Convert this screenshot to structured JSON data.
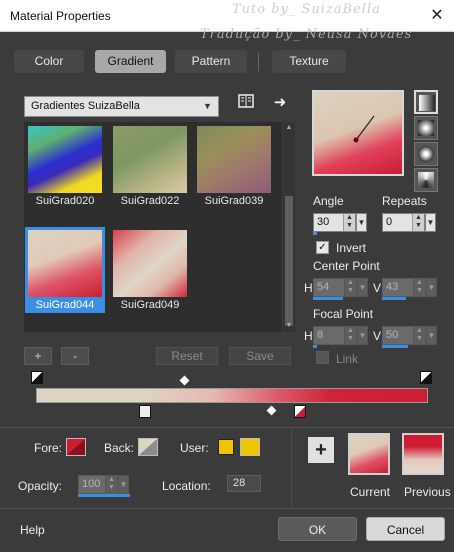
{
  "window": {
    "title": "Material Properties",
    "close_label": "✕"
  },
  "watermark": {
    "line1": "Tuto by_ SuizaBella",
    "line2": "Tradução by_ Neusa Novaes"
  },
  "tabs": [
    {
      "label": "Color",
      "active": false
    },
    {
      "label": "Gradient",
      "active": true
    },
    {
      "label": "Pattern",
      "active": false
    },
    {
      "label": "Texture",
      "active": false
    }
  ],
  "gradient_list": {
    "selected": "Gradientes SuizaBella",
    "items": [
      {
        "label": "SuiGrad020",
        "selected": false
      },
      {
        "label": "SuiGrad022",
        "selected": false
      },
      {
        "label": "SuiGrad039",
        "selected": false
      },
      {
        "label": "SuiGrad044",
        "selected": true
      },
      {
        "label": "SuiGrad049",
        "selected": false
      }
    ]
  },
  "list_buttons": {
    "add": "+",
    "remove": "-",
    "reset": "Reset",
    "save": "Save"
  },
  "angle": {
    "label": "Angle",
    "value": "30"
  },
  "repeats": {
    "label": "Repeats",
    "value": "0"
  },
  "invert": {
    "label": "Invert",
    "checked": true
  },
  "center_point": {
    "label": "Center Point",
    "h_label": "H",
    "h": "54",
    "v_label": "V",
    "v": "43"
  },
  "focal_point": {
    "label": "Focal Point",
    "h_label": "H",
    "h": "8",
    "v_label": "V",
    "v": "50"
  },
  "link": {
    "label": "Link",
    "checked": false
  },
  "bottom": {
    "fore_label": "Fore:",
    "back_label": "Back:",
    "user_label": "User:",
    "opacity_label": "Opacity:",
    "opacity_value": "100",
    "location_label": "Location:",
    "location_value": "28",
    "current_label": "Current",
    "previous_label": "Previous",
    "add_swatch": "+"
  },
  "footer": {
    "help": "Help",
    "ok": "OK",
    "cancel": "Cancel"
  },
  "colors": {
    "accent": "#3a8ee6",
    "gradient_red": "#cd1d33",
    "gradient_cream": "#ddd4c4",
    "user_yellow": "#f2c400"
  }
}
